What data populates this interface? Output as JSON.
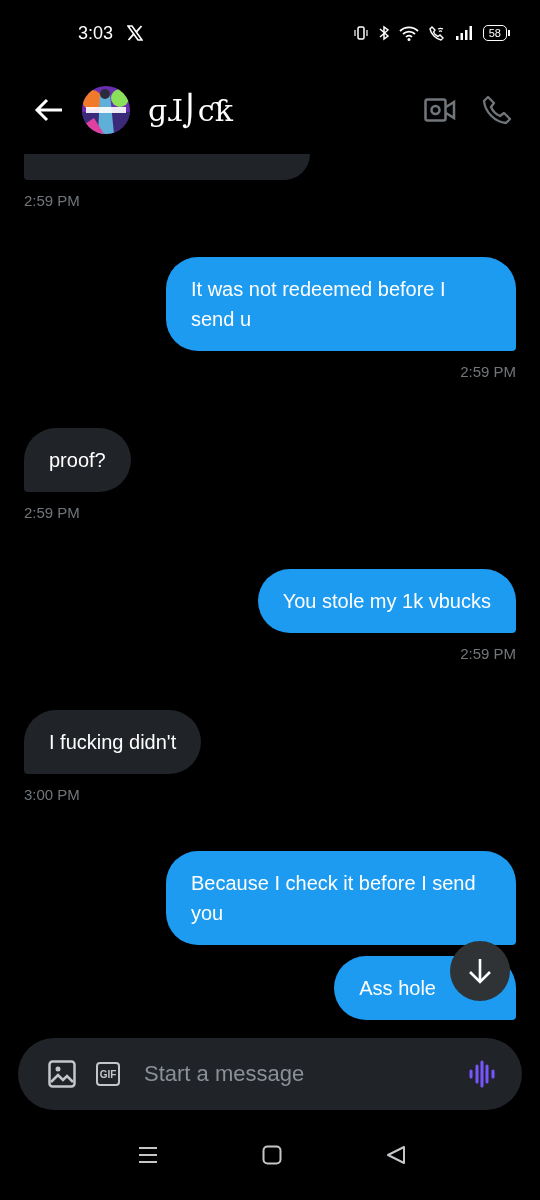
{
  "status_bar": {
    "time": "3:03",
    "battery": "58"
  },
  "header": {
    "name": "ɡɺ⌡ƈƙ"
  },
  "messages": [
    {
      "kind": "partial",
      "time": "2:59 PM"
    },
    {
      "kind": "sent",
      "text": "It was not redeemed before  I send u",
      "time": "2:59 PM"
    },
    {
      "kind": "received",
      "text": "proof?",
      "time": "2:59 PM"
    },
    {
      "kind": "sent",
      "text": "You stole my 1k vbucks",
      "time": "2:59 PM"
    },
    {
      "kind": "received",
      "text": "I fucking didn't",
      "time": "3:00 PM"
    },
    {
      "kind": "sent",
      "text": "Because I check it before I send you"
    },
    {
      "kind": "sent",
      "text": "Ass hole"
    }
  ],
  "composer": {
    "placeholder": "Start a message",
    "gif_label": "GIF"
  }
}
